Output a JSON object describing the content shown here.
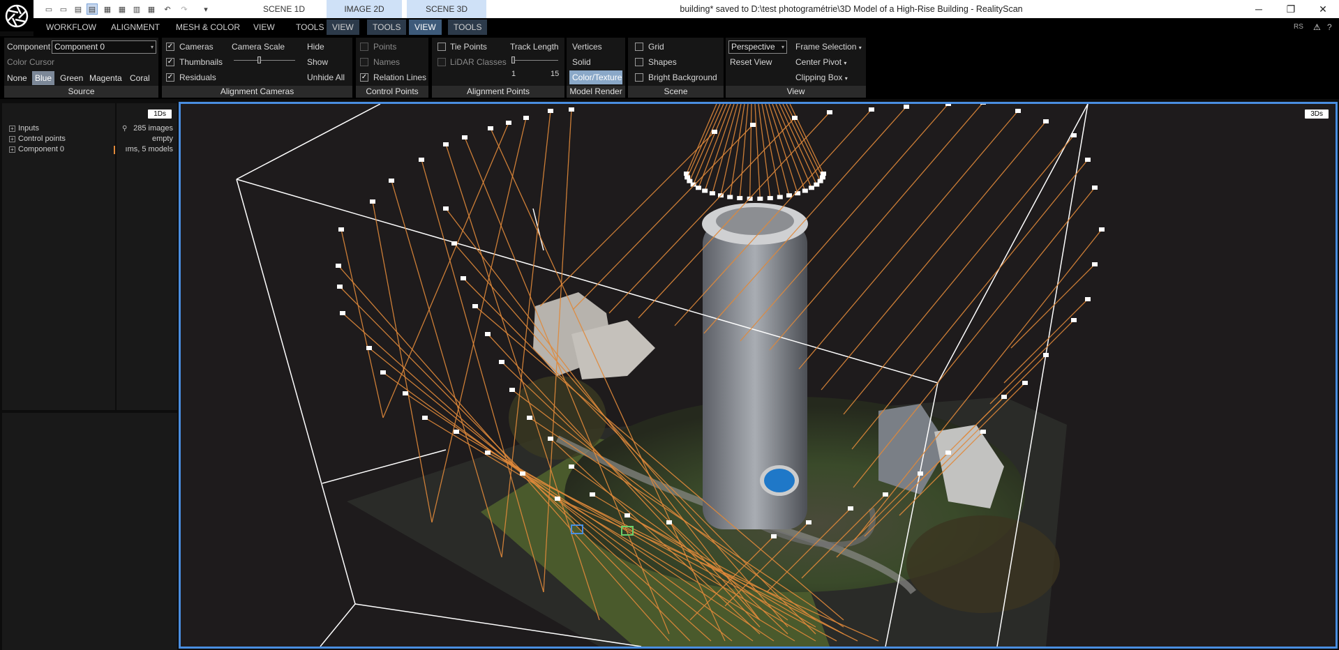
{
  "titlebar": {
    "title": "building* saved to D:\\test photogramétrie\\3D Model of a High-Rise Building - RealityScan",
    "scene_tabs": [
      "SCENE 1D",
      "IMAGE 2D",
      "SCENE 3D"
    ],
    "pin_glyph": "▾",
    "window_buttons": [
      "─",
      "❐",
      "✕"
    ]
  },
  "menubar": {
    "items": [
      "WORKFLOW",
      "ALIGNMENT",
      "MESH & COLOR",
      "VIEW",
      "TOOLS",
      "VIEW",
      "TOOLS",
      "VIEW",
      "TOOLS"
    ],
    "right_badge": "RS",
    "warning_icon": "⚠",
    "help_icon": "?"
  },
  "ribbon": {
    "source": {
      "title": "Source",
      "component_label": "Component",
      "component_value": "Component 0",
      "color_cursor_label": "Color Cursor",
      "colors": [
        "None",
        "Blue",
        "Green",
        "Magenta",
        "Coral"
      ],
      "selected_color": "Blue"
    },
    "alignment_cameras": {
      "title": "Alignment Cameras",
      "cameras": "Cameras",
      "thumbnails": "Thumbnails",
      "residuals": "Residuals",
      "camera_scale": "Camera Scale",
      "hide": "Hide",
      "show": "Show",
      "unhide_all": "Unhide All"
    },
    "control_points": {
      "title": "Control Points",
      "points": "Points",
      "names": "Names",
      "relation_lines": "Relation Lines"
    },
    "alignment_points": {
      "title": "Alignment Points",
      "tie_points": "Tie Points",
      "lidar_classes": "LiDAR Classes",
      "track_length": "Track Length",
      "track_min": "1",
      "track_max": "15"
    },
    "model_render": {
      "title": "Model Render",
      "vertices": "Vertices",
      "solid": "Solid",
      "color_texture": "Color/Texture"
    },
    "scene": {
      "title": "Scene",
      "grid": "Grid",
      "shapes": "Shapes",
      "bright_background": "Bright Background"
    },
    "view": {
      "title": "View",
      "projection": "Perspective",
      "reset_view": "Reset View",
      "frame_selection": "Frame Selection",
      "center_pivot": "Center Pivot",
      "clipping_box": "Clipping Box"
    }
  },
  "left_panel": {
    "badge_1ds": "1Ds",
    "tree": [
      {
        "label": "Inputs",
        "info": "285 images"
      },
      {
        "label": "Control points",
        "info": "empty"
      },
      {
        "label": "Component 0",
        "info": "ıms, 5 models"
      }
    ]
  },
  "viewport": {
    "badge_3ds": "3Ds",
    "colors": {
      "border": "#4a8ee0",
      "ray": "#e0893a",
      "box": "#ffffff",
      "background": "#1e1b1c"
    }
  }
}
